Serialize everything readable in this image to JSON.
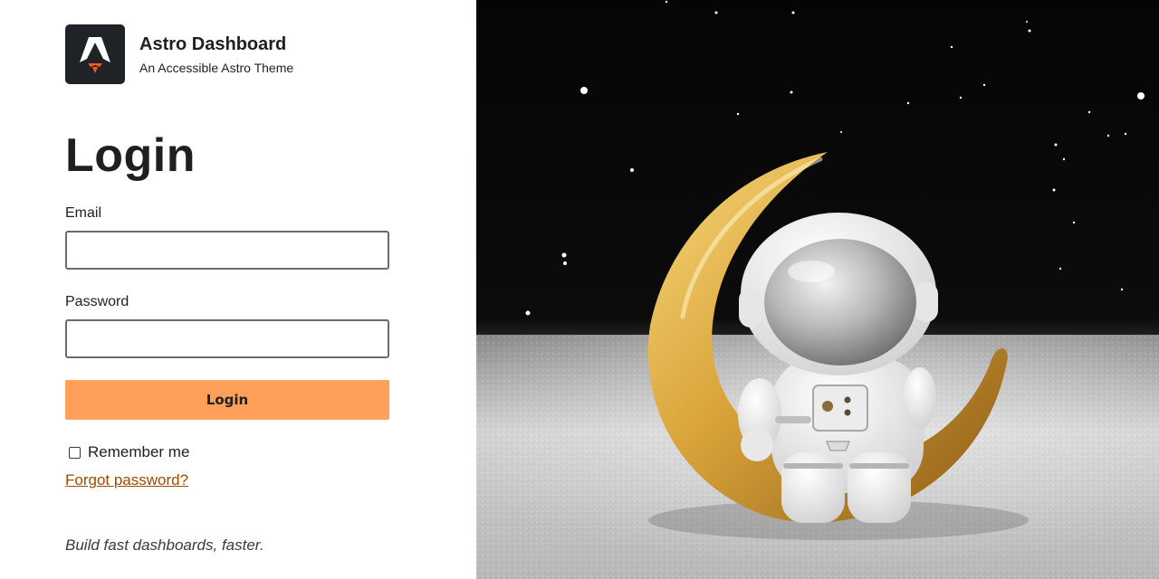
{
  "brand": {
    "title": "Astro Dashboard",
    "subtitle": "An Accessible Astro Theme",
    "logo_icon": "astro-rocket-logo-icon"
  },
  "login": {
    "heading": "Login",
    "email_label": "Email",
    "email_value": "",
    "password_label": "Password",
    "password_value": "",
    "submit_label": "Login",
    "remember_label": "Remember me",
    "remember_checked": false,
    "forgot_label": "Forgot password?"
  },
  "tagline": "Build fast dashboards, faster.",
  "colors": {
    "accent": "#ffa05a",
    "link": "#a04a00",
    "logo_bg": "#1f2328",
    "logo_flame": "#ff5a1f"
  }
}
